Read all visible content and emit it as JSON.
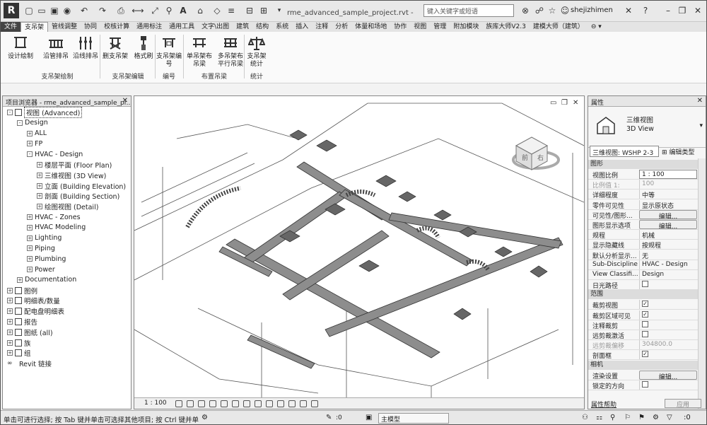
{
  "titlebar": {
    "logo": "R",
    "doc_title": "rme_advanced_sample_project.rvt - 三...",
    "search_placeholder": "键入关键字或短语",
    "user": "shejizhimen",
    "icons": [
      "new-icon",
      "open-icon",
      "save-icon",
      "sync-icon",
      "undo-icon",
      "redo-icon",
      "print-icon",
      "measure-icon",
      "dimension-icon",
      "text-icon",
      "3d-view-icon",
      "section-icon",
      "close-hidden-icon",
      "switch-window-icon",
      "search-binoculars-icon",
      "info-icon",
      "star-icon",
      "user-icon",
      "help-icon",
      "minimize-icon",
      "restore-icon",
      "close-icon"
    ]
  },
  "menu": {
    "tabs": [
      "文件",
      "支吊架",
      "管线调整",
      "协同",
      "校核计算",
      "通用标注",
      "通用工具",
      "文字\\出图",
      "建筑",
      "结构",
      "系统",
      "插入",
      "注释",
      "分析",
      "体量和场地",
      "协作",
      "视图",
      "管理",
      "附加模块",
      "族库大师V2.3",
      "建模大师（建筑）"
    ],
    "active_index": 1
  },
  "ribbon": {
    "buttons": [
      {
        "label": "设计绘制"
      },
      {
        "label": "沿管排吊"
      },
      {
        "label": "沿线排吊"
      },
      {
        "label": "删支吊架"
      },
      {
        "label": "格式刷"
      },
      {
        "label": "支吊架编\n号"
      },
      {
        "label": "单吊架布\n吊梁"
      },
      {
        "label": "多吊架布\n平行吊梁"
      },
      {
        "label": "支吊架\n统计"
      }
    ],
    "panels": [
      "支吊架绘制",
      "支吊架编辑",
      "编号",
      "布置吊梁",
      "统计"
    ]
  },
  "browser": {
    "title": "项目浏览器 - rme_advanced_sample_pr...",
    "items": [
      {
        "label": "视图 (Advanced)",
        "level": 0,
        "toggle": "-",
        "icon": "view",
        "selected": true
      },
      {
        "label": "Design",
        "level": 1,
        "toggle": "-"
      },
      {
        "label": "ALL",
        "level": 2,
        "toggle": "+"
      },
      {
        "label": "FP",
        "level": 2,
        "toggle": "+"
      },
      {
        "label": "HVAC - Design",
        "level": 2,
        "toggle": "-"
      },
      {
        "label": "楼层平面 (Floor Plan)",
        "level": 3,
        "toggle": "+"
      },
      {
        "label": "三维视图 (3D View)",
        "level": 3,
        "toggle": "+"
      },
      {
        "label": "立面 (Building Elevation)",
        "level": 3,
        "toggle": "+"
      },
      {
        "label": "剖面 (Building Section)",
        "level": 3,
        "toggle": "+"
      },
      {
        "label": "绘图视图 (Detail)",
        "level": 3,
        "toggle": "+"
      },
      {
        "label": "HVAC - Zones",
        "level": 2,
        "toggle": "+"
      },
      {
        "label": "HVAC Modeling",
        "level": 2,
        "toggle": "+"
      },
      {
        "label": "Lighting",
        "level": 2,
        "toggle": "+"
      },
      {
        "label": "Piping",
        "level": 2,
        "toggle": "+"
      },
      {
        "label": "Plumbing",
        "level": 2,
        "toggle": "+"
      },
      {
        "label": "Power",
        "level": 2,
        "toggle": "+"
      },
      {
        "label": "Documentation",
        "level": 1,
        "toggle": "+"
      },
      {
        "label": "图例",
        "level": 0,
        "toggle": "+",
        "icon": "box"
      },
      {
        "label": "明细表/数量",
        "level": 0,
        "toggle": "+",
        "icon": "box"
      },
      {
        "label": "配电盘明细表",
        "level": 0,
        "toggle": "+",
        "icon": "box"
      },
      {
        "label": "报告",
        "level": 0,
        "toggle": "+",
        "icon": "box"
      },
      {
        "label": "图纸 (all)",
        "level": 0,
        "toggle": "+",
        "icon": "box"
      },
      {
        "label": "族",
        "level": 0,
        "toggle": "+",
        "icon": "box"
      },
      {
        "label": "组",
        "level": 0,
        "toggle": "+",
        "icon": "box"
      },
      {
        "label": "Revit 链接",
        "level": 0,
        "toggle": "",
        "icon": "chain"
      }
    ]
  },
  "viewport": {
    "scale": "1 : 100",
    "controls": [
      "minimize-view-icon",
      "restore-view-icon",
      "close-view-icon"
    ],
    "viewcube_faces": {
      "front": "前",
      "right": "右"
    }
  },
  "properties": {
    "title": "属性",
    "type_line1": "三维视图",
    "type_line2": "3D View",
    "view_select": "三维视图: WSHP 2-3",
    "edit_type": "编辑类型",
    "groups": [
      {
        "title": "图形",
        "rows": [
          {
            "k": "视图比例",
            "v": "1 : 100",
            "style": "box"
          },
          {
            "k": "比例值 1:",
            "v": "100",
            "style": "dim"
          },
          {
            "k": "详细程度",
            "v": "中等"
          },
          {
            "k": "零件可见性",
            "v": "显示原状态"
          },
          {
            "k": "可见性/图形...",
            "v": "编辑...",
            "style": "btn"
          },
          {
            "k": "图形显示选项",
            "v": "编辑...",
            "style": "btn"
          },
          {
            "k": "规程",
            "v": "机械"
          },
          {
            "k": "显示隐藏线",
            "v": "按规程"
          },
          {
            "k": "默认分析显示...",
            "v": "无"
          },
          {
            "k": "Sub-Discipline",
            "v": "HVAC - Design"
          },
          {
            "k": "View Classifi...",
            "v": "Design"
          },
          {
            "k": "日光路径",
            "v": "",
            "style": "check"
          }
        ]
      },
      {
        "title": "范围",
        "rows": [
          {
            "k": "裁剪视图",
            "v": "✓",
            "style": "check"
          },
          {
            "k": "裁剪区域可见",
            "v": "✓",
            "style": "check"
          },
          {
            "k": "注释裁剪",
            "v": "",
            "style": "check"
          },
          {
            "k": "远剪裁激活",
            "v": "",
            "style": "check"
          },
          {
            "k": "远剪裁偏移",
            "v": "304800.0",
            "style": "dim"
          },
          {
            "k": "剖面框",
            "v": "✓",
            "style": "check"
          }
        ]
      },
      {
        "title": "相机",
        "rows": [
          {
            "k": "渲染设置",
            "v": "编辑...",
            "style": "btn"
          },
          {
            "k": "锁定的方向",
            "v": "",
            "style": "check"
          }
        ]
      }
    ],
    "help_link": "属性帮助",
    "apply": "应用"
  },
  "status": {
    "text": "单击可进行选择; 按 Tab 键并单击可选择其他项目; 按 Ctrl 键并单击...",
    "count": ":0",
    "model": "主模型"
  }
}
